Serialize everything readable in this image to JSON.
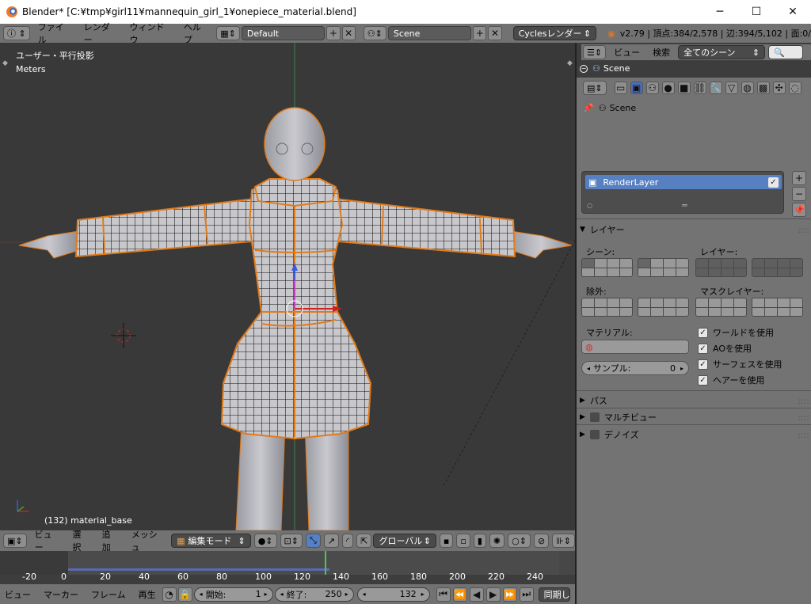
{
  "window": {
    "title": "Blender* [C:¥tmp¥girl11¥mannequin_girl_1¥onepiece_material.blend]",
    "min": "─",
    "max": "☐",
    "close": "✕"
  },
  "header": {
    "info_icon": "ⓘ",
    "menus": [
      "ファイル",
      "レンダー",
      "ウィンドウ",
      "ヘルプ"
    ],
    "layout": "Default",
    "scene": "Scene",
    "engine": "Cyclesレンダー",
    "stats": "v2.79 | 頂点:384/2,578 | 辺:394/5,102 | 面:0/"
  },
  "viewport": {
    "view_label": "ユーザー・平行投影",
    "units": "Meters",
    "object_label": "(132) material_base"
  },
  "outliner": {
    "menus": [
      "ビュー",
      "検索"
    ],
    "filter": "全てのシーン",
    "root": "Scene"
  },
  "properties": {
    "scene_label": "Scene",
    "renderlayer": "RenderLayer",
    "layer_section": "レイヤー",
    "scene_col": "シーン:",
    "layer_col": "レイヤー:",
    "exclude": "除外:",
    "mask_layer": "マスクレイヤー:",
    "material": "マテリアル:",
    "samples_label": "サンプル:",
    "samples_value": "0",
    "checks": [
      "ワールドを使用",
      "AOを使用",
      "サーフェスを使用",
      "ヘアーを使用"
    ],
    "passes": "パス",
    "multiview": "マルチビュー",
    "denoise": "デノイズ"
  },
  "viewheader": {
    "menus": [
      "ビュー",
      "選択",
      "追加",
      "メッシュ"
    ],
    "mode": "編集モード",
    "orientation": "グローバル"
  },
  "timeline": {
    "ticks": [
      "-20",
      "0",
      "20",
      "40",
      "60",
      "80",
      "100",
      "120",
      "140",
      "160",
      "180",
      "200",
      "220",
      "240"
    ]
  },
  "footer": {
    "menus": [
      "ビュー",
      "マーカー",
      "フレーム",
      "再生"
    ],
    "start_label": "開始:",
    "start": "1",
    "end_label": "終了:",
    "end": "250",
    "current": "132",
    "sync": "同期し"
  }
}
